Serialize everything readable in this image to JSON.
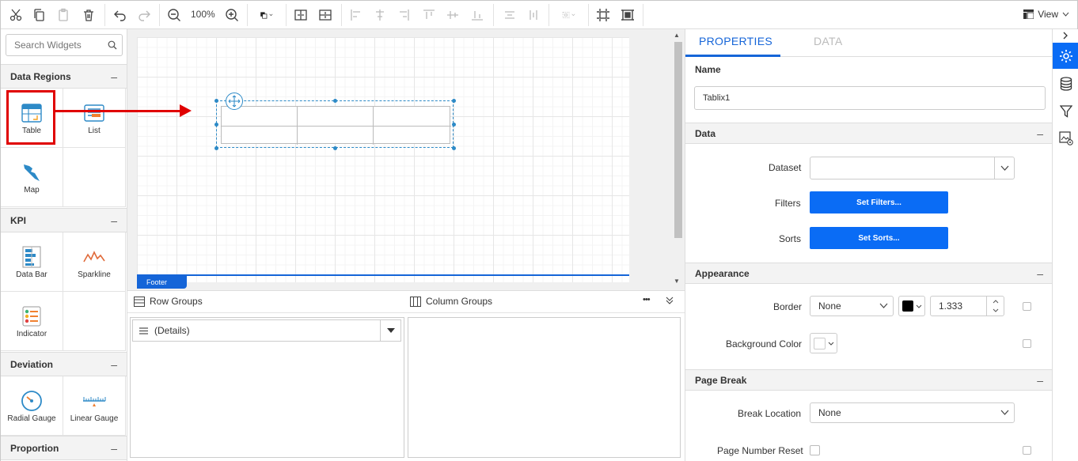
{
  "toolbar": {
    "zoom": "100%",
    "view_label": "View"
  },
  "widgets": {
    "search_placeholder": "Search Widgets",
    "sections": {
      "data_regions": "Data Regions",
      "kpi": "KPI",
      "deviation": "Deviation",
      "proportion": "Proportion"
    },
    "collapse_symbol": "–",
    "items": {
      "table": "Table",
      "list": "List",
      "map": "Map",
      "data_bar": "Data Bar",
      "sparkline": "Sparkline",
      "indicator": "Indicator",
      "radial_gauge": "Radial Gauge",
      "linear_gauge": "Linear Gauge"
    }
  },
  "canvas": {
    "footer_label": "Footer"
  },
  "groups": {
    "row_groups": "Row Groups",
    "column_groups": "Column Groups",
    "more": "•••",
    "details": "(Details)"
  },
  "properties": {
    "tabs": {
      "properties": "PROPERTIES",
      "data": "DATA"
    },
    "name_label": "Name",
    "name_value": "Tablix1",
    "sections": {
      "data": "Data",
      "appearance": "Appearance",
      "page_break": "Page Break"
    },
    "dataset_label": "Dataset",
    "dataset_value": "",
    "filters_label": "Filters",
    "filters_button": "Set Filters...",
    "sorts_label": "Sorts",
    "sorts_button": "Set Sorts...",
    "border_label": "Border",
    "border_style": "None",
    "border_width": "1.333",
    "border_color": "#000000",
    "background_label": "Background Color",
    "break_location_label": "Break Location",
    "break_location_value": "None",
    "page_number_reset_label": "Page Number Reset"
  },
  "colors": {
    "accent": "#0a6cf5",
    "highlight": "#e00000"
  }
}
